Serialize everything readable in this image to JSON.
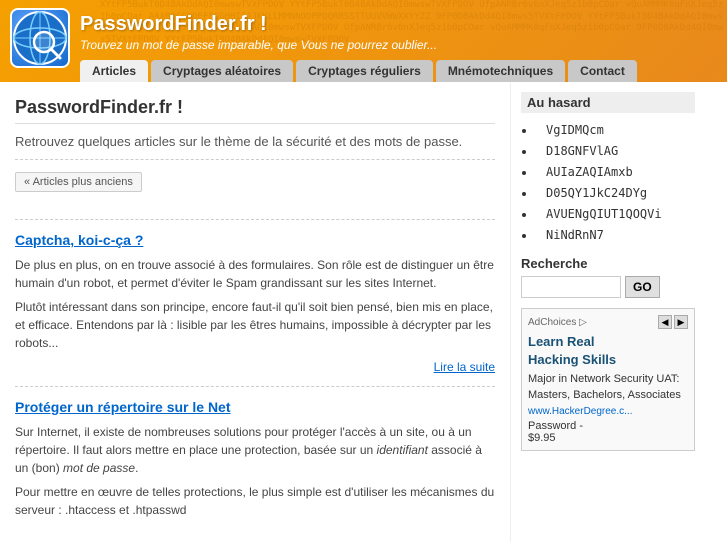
{
  "header": {
    "title": "PasswordFinder.fr !",
    "subtitle": "Trouvez un mot de passe imparable, que Vous ne pourrez oublier...",
    "bg_text": "XYtFP5BukT0D4BAkDdAQI0mwswTVXFPDOV YYtFP5BukT0D4BAkDdAQI0mwswTVXFPDOV UfpANRBr6v6nXJeq5z1b0pCOar vQuAMMMK0qFnXJeq5z1b0pCOar AAABBCCDDEFFGGHHIIJJKKLLMMNNOOPPQQRRSSTTUUVVWWXXYYZZ 9FP0D8AkDd4QI0mws5TVXtFPDOV YYtFP5BukT0D4BAkDdAQI0mwswTVXFPDOV"
  },
  "nav": {
    "tabs": [
      {
        "label": "Articles",
        "active": true
      },
      {
        "label": "Cryptages aléatoires",
        "active": false
      },
      {
        "label": "Cryptages réguliers",
        "active": false
      },
      {
        "label": "Mnémotechniques",
        "active": false
      },
      {
        "label": "Contact",
        "active": false
      }
    ]
  },
  "main": {
    "page_title": "PasswordFinder.fr !",
    "page_desc": "Retrouvez quelques articles sur le thème de la sécurité et des mots de passe.",
    "older_articles_btn": "« Articles plus anciens",
    "articles": [
      {
        "title": "Captcha, koi-c-ça ?",
        "paragraphs": [
          "De plus en plus, on en trouve associé à des formulaires. Son rôle est de distinguer un être humain d'un robot, et permet d'éviter le Spam grandissant sur les sites Internet.",
          "Plutôt intéressant dans son principe, encore faut-il qu'il soit bien pensé, bien mis en place, et efficace. Entendons par là : lisible par les êtres humains, impossible à décrypter par les robots..."
        ],
        "read_more": "Lire la suite"
      },
      {
        "title": "Protéger un répertoire sur le Net",
        "paragraphs": [
          "Sur Internet, il existe de nombreuses solutions pour protéger l'accès à un site, ou à un répertoire. Il faut alors mettre en place une protection, basée sur un identifiant associé à un (bon) mot de passe.",
          "Pour mettre en œuvre de telles protections, le plus simple est d'utiliser les mécanismes du serveur : .htaccess et .htpasswd"
        ],
        "read_more": ""
      }
    ]
  },
  "sidebar": {
    "random_title": "Au hasard",
    "passwords": [
      "VgIDMQcm",
      "D18GNFVlAG",
      "AUIaZAQIAmxb",
      "D05QY1JkC24DYg",
      "AVUENgQIUT1QOQVi",
      "NiNdRnN7"
    ],
    "search_label": "Recherche",
    "search_placeholder": "",
    "search_btn": "GO",
    "ad": {
      "choices_label": "AdChoices ▷",
      "title": "Learn Real\nHacking Skills",
      "body": "Major in Network Security UAT: Masters, Bachelors, Associates",
      "url": "www.HackerDegree.c...",
      "price": "Password -\n$9.95"
    }
  }
}
